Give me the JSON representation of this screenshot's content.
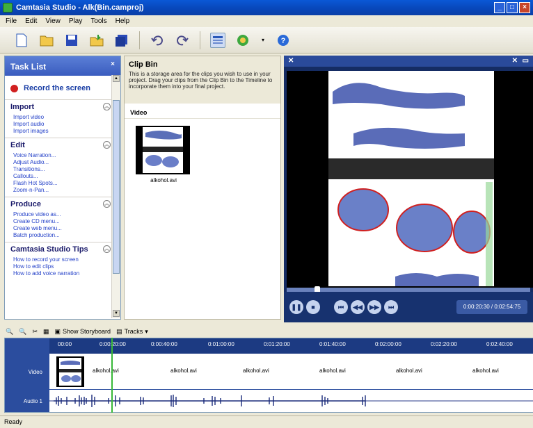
{
  "window": {
    "title": "Camtasia Studio - Alk(Bin.camproj)",
    "controls": [
      "_",
      "□",
      "×"
    ]
  },
  "menu": [
    "File",
    "Edit",
    "View",
    "Play",
    "Tools",
    "Help"
  ],
  "tasklist": {
    "header": "Task List",
    "close": "×",
    "record": "Record the screen",
    "sections": [
      {
        "title": "Import",
        "links": [
          "Import video",
          "Import audio",
          "Import images"
        ]
      },
      {
        "title": "Edit",
        "links": [
          "Voice Narration...",
          "Adjust Audio...",
          "Transitions...",
          "Callouts...",
          "Flash Hot Spots...",
          "Zoom-n-Pan..."
        ]
      },
      {
        "title": "Produce",
        "links": [
          "Produce video as...",
          "Create CD menu...",
          "Create web menu...",
          "Batch production..."
        ]
      },
      {
        "title": "Camtasia Studio Tips",
        "links": [
          "How to record your screen",
          "How to edit clips",
          "How to add voice narration"
        ]
      }
    ]
  },
  "clipbin": {
    "title": "Clip Bin",
    "description": "This is a storage area for the clips you wish to use in your project. Drag your clips from the Clip Bin to the Timeline to incorporate them into your final project.",
    "video_header": "Video",
    "clip_name": "alkohol.avi"
  },
  "preview": {
    "time": "0:00:20:30 / 0:02:54:75"
  },
  "timeline_toolbar": {
    "storyboard": "Show Storyboard",
    "tracks": "Tracks"
  },
  "timeline": {
    "ticks": [
      "00:00",
      "0:00:20:00",
      "0:00:40:00",
      "0:01:00:00",
      "0:01:20:00",
      "0:01:40:00",
      "0:02:00:00",
      "0:02:20:00",
      "0:02:40:00"
    ],
    "video_label": "Video",
    "audio_label": "Audio 1",
    "clip_labels": [
      "alkohol.avi",
      "alkohol.avi",
      "alkohol.avi",
      "alkohol.avi",
      "alkohol.avi",
      "alkohol.avi"
    ]
  },
  "status": "Ready"
}
